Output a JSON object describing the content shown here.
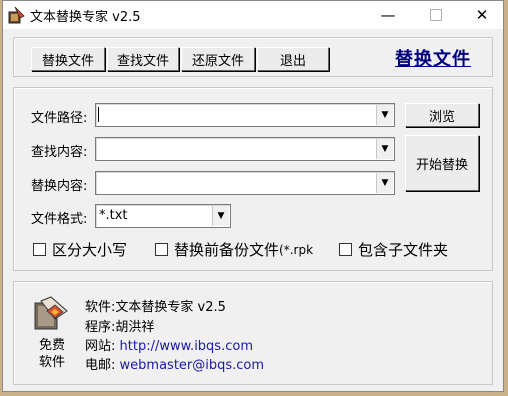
{
  "window": {
    "title": "文本替换专家 v2.5",
    "controls": {
      "minimize": "—",
      "close": "✕"
    }
  },
  "toolbar": {
    "replace_files": "替换文件",
    "find_files": "查找文件",
    "restore_files": "还原文件",
    "exit": "退出",
    "mode_title": "替换文件"
  },
  "form": {
    "path_label": "文件路径:",
    "path_value": "",
    "find_label": "查找内容:",
    "find_value": "",
    "replace_label": "替换内容:",
    "replace_value": "",
    "format_label": "文件格式:",
    "format_value": "*.txt",
    "browse": "浏览",
    "start": "开始替换",
    "dropdown_arrow": "▼"
  },
  "options": {
    "case_sensitive": "区分大小写",
    "backup_prefix": "替换前备份文件",
    "backup_ext": "(*.rpk",
    "include_subfolders": "包含子文件夹"
  },
  "about": {
    "free_line1": "免费",
    "free_line2": "软件",
    "software": "软件:文本替换专家 v2.5",
    "author": "程序:胡洪祥",
    "website_label": "网站:",
    "website": "http://www.ibqs.com",
    "email_label": "电邮:",
    "email": "webmaster@ibqs.com"
  },
  "colors": {
    "window_bg": "#f0f0f0",
    "title_link": "#000080",
    "link": "#1a1aa6",
    "desktop": "#c9b28a"
  },
  "icons": [
    "app-icon",
    "minimize-icon",
    "maximize-icon",
    "close-icon",
    "dropdown-arrow-icon",
    "software-logo-icon"
  ]
}
